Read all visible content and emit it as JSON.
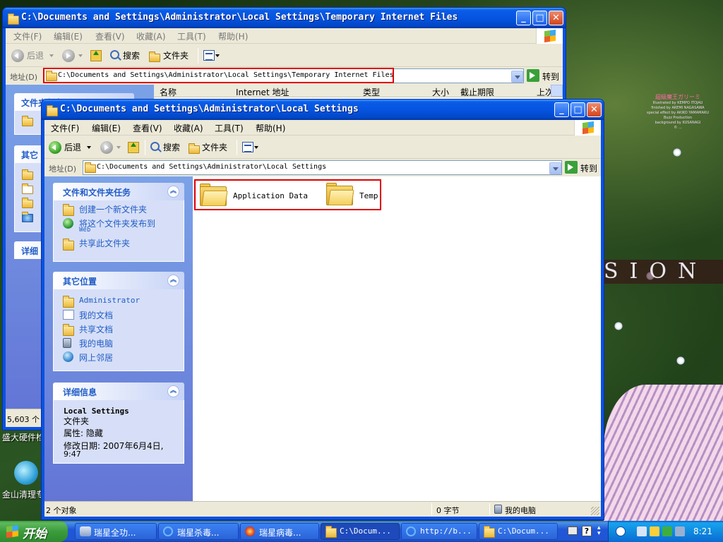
{
  "desktop": {
    "banner_text": "SION",
    "credits_head": "超級魔王ガリーミ",
    "credits_lines": [
      "Illustrated by KEMPO ITOJAU",
      "finished by AKEMI NAGASAWA",
      "special effect by AKIKO YAMAMARU",
      "Buzz Production",
      "background by KUSANAGI",
      "© ..."
    ],
    "icon_label_1": "盛大硬件检",
    "icon_label_2": "金山清理专"
  },
  "back_window": {
    "title": "C:\\Documents and Settings\\Administrator\\Local Settings\\Temporary Internet Files",
    "menu": [
      "文件(F)",
      "编辑(E)",
      "查看(V)",
      "收藏(A)",
      "工具(T)",
      "帮助(H)"
    ],
    "toolbar": {
      "back": "后退",
      "search": "搜索",
      "folders": "文件夹"
    },
    "address_label": "地址(D)",
    "address_value": "C:\\Documents and Settings\\Administrator\\Local Settings\\Temporary Internet Files",
    "go_label": "转到",
    "columns": [
      "名称",
      "Internet 地址",
      "类型",
      "大小",
      "截止期限",
      "上次"
    ],
    "pane_visible": [
      "文件夹任务",
      "其它",
      "详细"
    ],
    "status_text": "5,603 个"
  },
  "front_window": {
    "title": "C:\\Documents and Settings\\Administrator\\Local Settings",
    "menu": [
      "文件(F)",
      "编辑(E)",
      "查看(V)",
      "收藏(A)",
      "工具(T)",
      "帮助(H)"
    ],
    "toolbar": {
      "back": "后退",
      "search": "搜索",
      "folders": "文件夹"
    },
    "address_label": "地址(D)",
    "address_value": "C:\\Documents and Settings\\Administrator\\Local Settings",
    "go_label": "转到",
    "tasks_panel": {
      "title": "文件和文件夹任务",
      "items": [
        "创建一个新文件夹",
        "将这个文件夹发布到",
        "Web",
        "共享此文件夹"
      ]
    },
    "places_panel": {
      "title": "其它位置",
      "items": [
        "Administrator",
        "我的文档",
        "共享文档",
        "我的电脑",
        "网上邻居"
      ]
    },
    "details_panel": {
      "title": "详细信息",
      "name": "Local Settings",
      "type": "文件夹",
      "attributes": "属性: 隐藏",
      "modified": "修改日期: 2007年6月4日,",
      "modified_time": "9:47"
    },
    "folders": [
      {
        "name": "Application Data"
      },
      {
        "name": "Temp"
      }
    ],
    "status": {
      "count": "2 个对象",
      "size": "0 字节",
      "location": "我的电脑"
    }
  },
  "taskbar": {
    "start_label": "开始",
    "tasks": [
      "瑞星全功...",
      "瑞星杀毒...",
      "瑞星病毒...",
      "C:\\Docum...",
      "http://b...",
      "C:\\Docum..."
    ],
    "time": "8:21"
  }
}
